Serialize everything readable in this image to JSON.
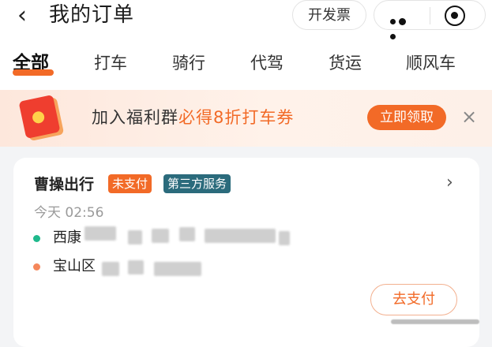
{
  "header": {
    "back_icon": "‹",
    "title": "我的订单",
    "invoice_label": "开发票"
  },
  "tabs": [
    {
      "label": "全部",
      "active": true
    },
    {
      "label": "打车",
      "active": false
    },
    {
      "label": "骑行",
      "active": false
    },
    {
      "label": "代驾",
      "active": false
    },
    {
      "label": "货运",
      "active": false
    },
    {
      "label": "顺风车",
      "active": false
    }
  ],
  "banner": {
    "text_prefix": "加入福利群",
    "text_highlight": "必得8折打车券",
    "button_label": "立即领取",
    "close_icon": "×"
  },
  "order": {
    "company": "曹操出行",
    "status_badge": "未支付",
    "service_badge": "第三方服务",
    "time": "今天 02:56",
    "start_address_visible": "西康",
    "end_address_visible": "宝山区",
    "pay_button_label": "去支付"
  },
  "colors": {
    "accent": "#f26a27",
    "service_badge": "#2b6b7c",
    "start_dot": "#1fb98c",
    "end_dot": "#f5875b"
  }
}
